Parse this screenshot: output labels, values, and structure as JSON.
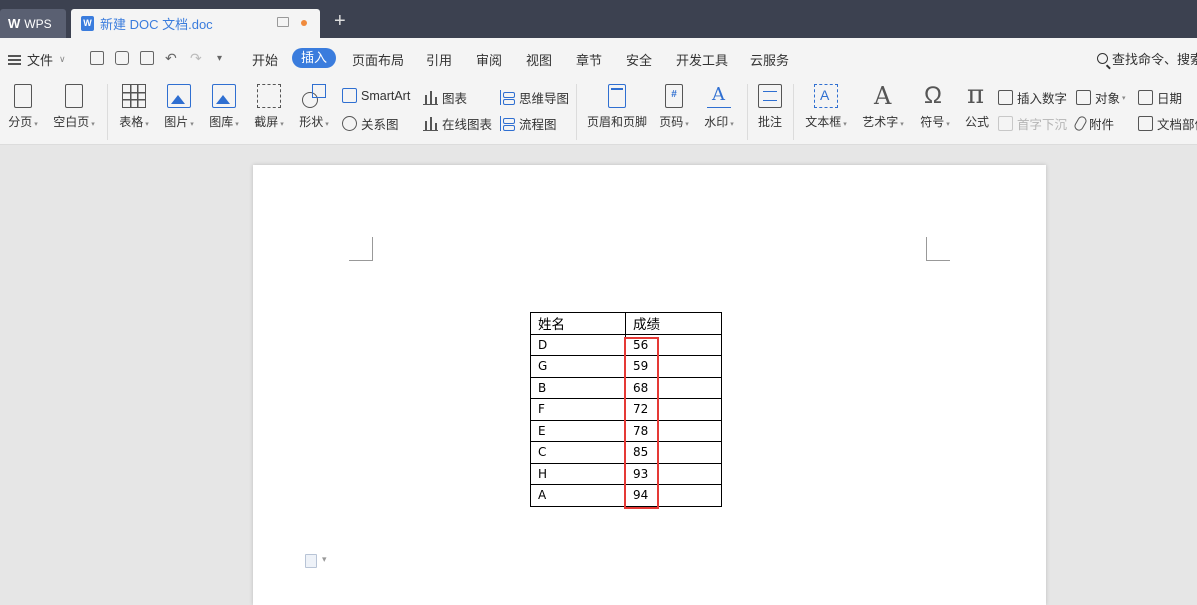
{
  "tabs": {
    "app_label": "WPS",
    "document_title": "新建 DOC 文档.doc",
    "new_tab": "+"
  },
  "menu": {
    "file": "文件",
    "tabs": [
      "开始",
      "插入",
      "页面布局",
      "引用",
      "审阅",
      "视图",
      "章节",
      "安全",
      "开发工具",
      "云服务"
    ],
    "active_tab": "插入",
    "search": "查找命令、搜索"
  },
  "ribbon": {
    "page_break": "分页",
    "blank_page": "空白页",
    "table": "表格",
    "picture": "图片",
    "gallery": "图库",
    "screenshot": "截屏",
    "shape": "形状",
    "smartart": "SmartArt",
    "chart": "图表",
    "mindmap": "思维导图",
    "relation": "关系图",
    "online_chart": "在线图表",
    "flowchart": "流程图",
    "header_footer": "页眉和页脚",
    "page_number": "页码",
    "watermark": "水印",
    "comment": "批注",
    "textbox": "文本框",
    "wordart": "艺术字",
    "symbol": "符号",
    "formula": "公式",
    "insert_number": "插入数字",
    "dropcap": "首字下沉",
    "object": "对象",
    "attachment": "附件",
    "date": "日期",
    "doc_parts": "文档部件"
  },
  "table": {
    "headers": [
      "姓名",
      "成绩"
    ],
    "rows": [
      [
        "D",
        "56"
      ],
      [
        "G",
        "59"
      ],
      [
        "B",
        "68"
      ],
      [
        "F",
        "72"
      ],
      [
        "E",
        "78"
      ],
      [
        "C",
        "85"
      ],
      [
        "H",
        "93"
      ],
      [
        "A",
        "94"
      ]
    ]
  },
  "colors": {
    "accent": "#3a7cdd",
    "highlight_border": "#e53935",
    "titlebar": "#3c4150"
  }
}
